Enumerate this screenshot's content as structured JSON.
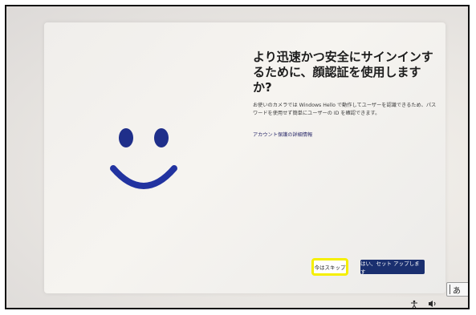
{
  "dialog": {
    "title": "より迅速かつ安全にサインインするために、顔認証を使用しますか?",
    "description": "お使いのカメラでは Windows Hello で動作してユーザーを認識できるため、パスワードを使用せず簡単にユーザーの ID を確認できます。",
    "link_label": "アカウント保護の詳細情報",
    "skip_button_label": "今はスキップ",
    "setup_button_label": "はい、セット アップします"
  },
  "ime": {
    "mode_glyph": "あ"
  },
  "tray": {
    "network_icon": "accessibility-icon",
    "volume_icon": "volume-icon"
  },
  "colors": {
    "primary_button": "#1a2f6f",
    "highlight": "#f5ef00",
    "smiley": "#1f2f8a"
  }
}
